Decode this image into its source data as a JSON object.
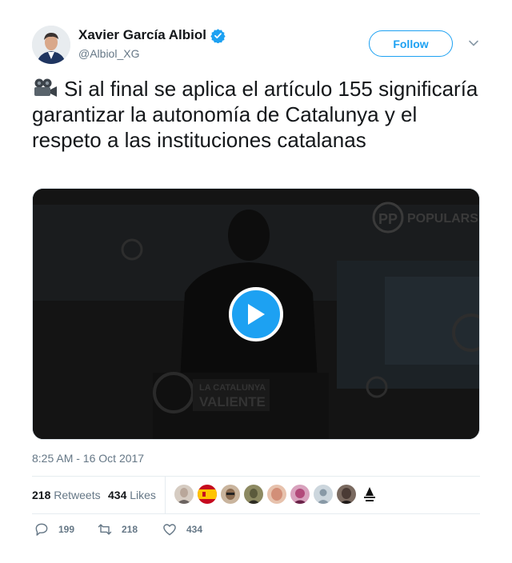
{
  "user": {
    "display_name": "Xavier García Albiol",
    "handle": "@Albiol_XG",
    "verified": true
  },
  "follow_label": "Follow",
  "tweet": {
    "emoji": "movie-camera-icon",
    "text": "Si al final se aplica el artículo 155 significaría garantizar la autonomía de Catalunya y el respeto a las instituciones catalanas"
  },
  "media": {
    "type": "video",
    "logo_text": "POPULARS",
    "banner_text": [
      "LA CATALUNYA",
      "VALIENTE"
    ]
  },
  "timestamp": "8:25 AM - 16 Oct 2017",
  "stats": {
    "retweets_count": "218",
    "retweets_label": "Retweets",
    "likes_count": "434",
    "likes_label": "Likes"
  },
  "likers": [
    {
      "name": "liker-1",
      "color": "#b9a79a"
    },
    {
      "name": "liker-2-spain-flag",
      "color": "#c60b1e"
    },
    {
      "name": "liker-3",
      "color": "#8a6a4f"
    },
    {
      "name": "liker-4",
      "color": "#5b5a3c"
    },
    {
      "name": "liker-5",
      "color": "#d28f78"
    },
    {
      "name": "liker-6",
      "color": "#b24a7a"
    },
    {
      "name": "liker-7-default",
      "color": "#aab8c2"
    },
    {
      "name": "liker-8",
      "color": "#4a3b35"
    },
    {
      "name": "liker-9",
      "color": "#ffffff"
    }
  ],
  "actions": {
    "replies": "199",
    "retweets": "218",
    "likes": "434"
  },
  "colors": {
    "accent": "#1da1f2",
    "text": "#14171a",
    "muted": "#657786",
    "border": "#e6ecf0"
  }
}
